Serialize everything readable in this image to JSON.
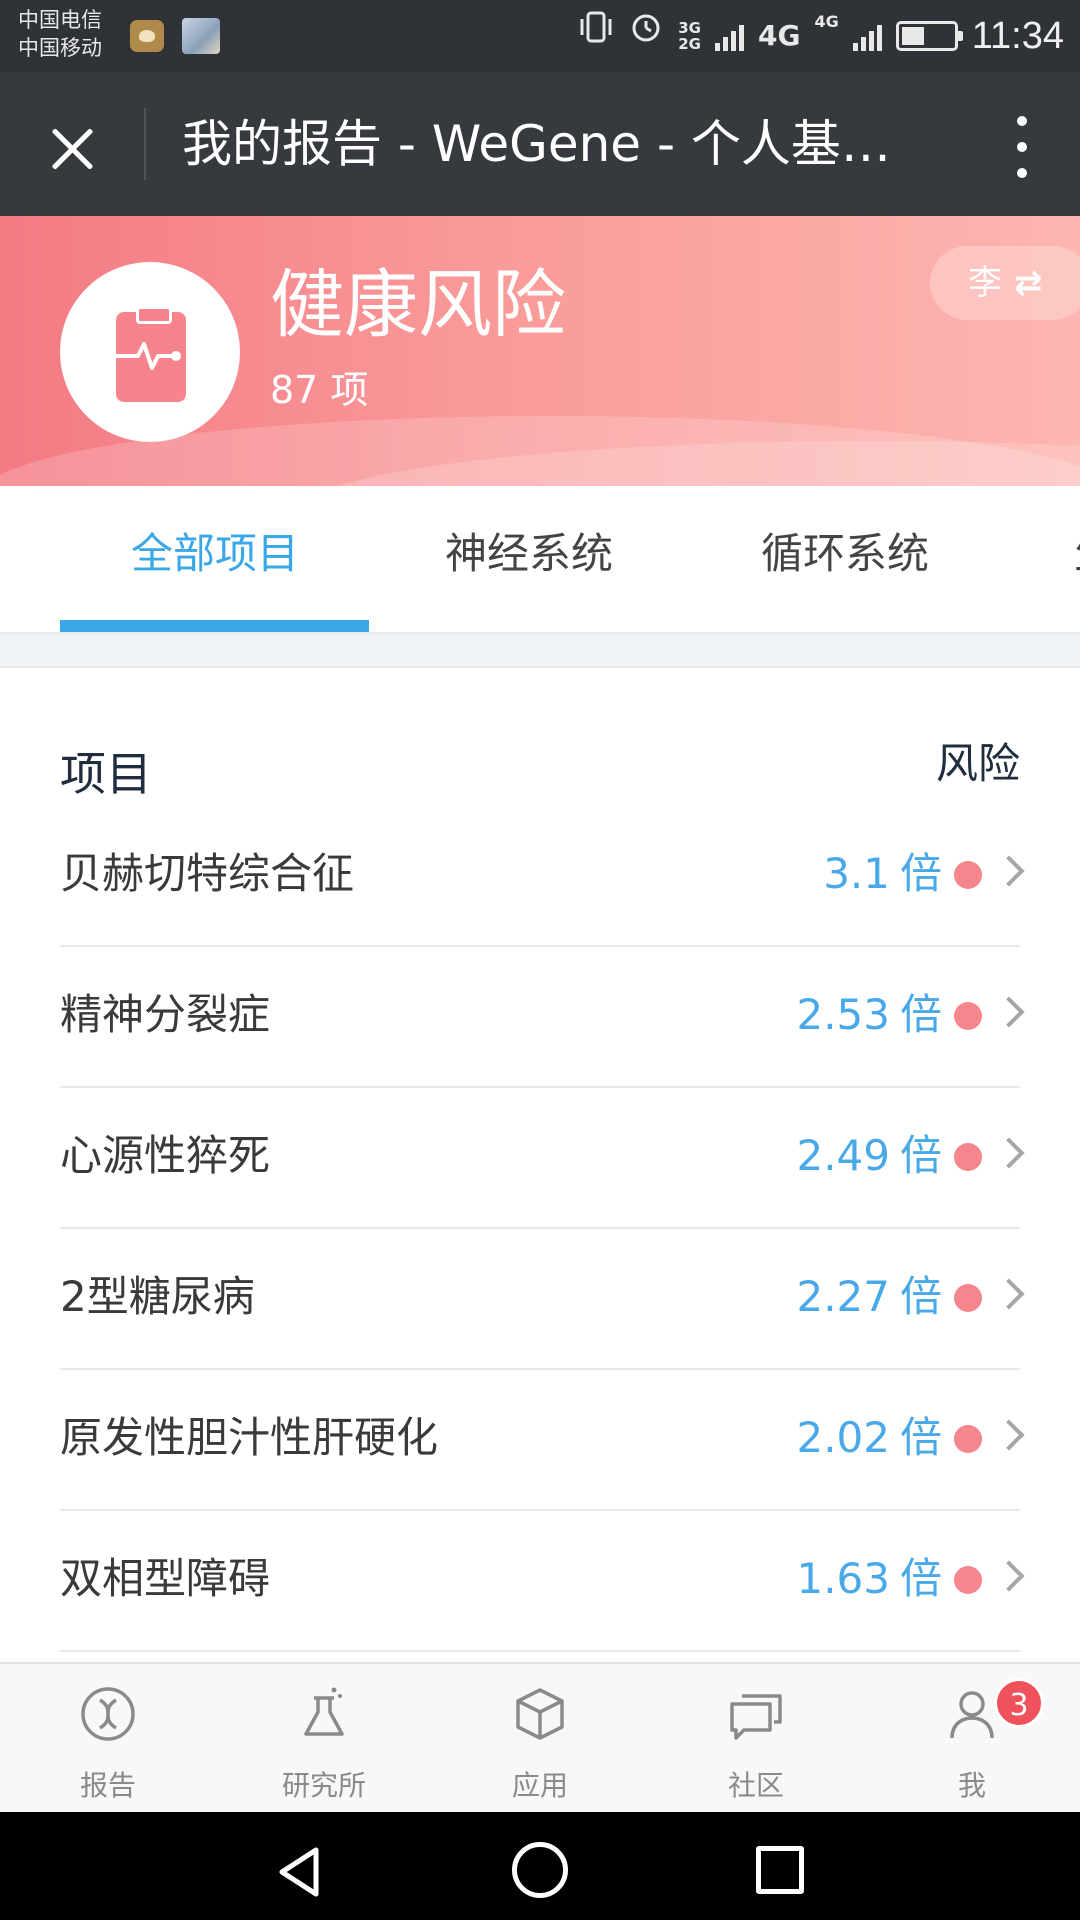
{
  "status_bar": {
    "carrier_1": "中国电信",
    "carrier_2": "中国移动",
    "net_3g": "3G",
    "net_2g": "2G",
    "net_4g_a": "4G",
    "net_4g_b": "4G",
    "time": "11:34",
    "icons": [
      "vibrate-icon",
      "alarm-icon",
      "signal-icon",
      "battery-icon"
    ]
  },
  "title_bar": {
    "title": "我的报告 - WeGene - 个人基…"
  },
  "category": {
    "title": "健康风险",
    "count": "87 项",
    "user_switch_label": "李",
    "swap_glyph": "⇄",
    "icon": "clipboard-pulse-icon"
  },
  "tabs": [
    {
      "label": "全部项目",
      "active": true
    },
    {
      "label": "神经系统",
      "active": false
    },
    {
      "label": "循环系统",
      "active": false
    },
    {
      "label": "生",
      "active": false
    }
  ],
  "list": {
    "header_left": "项目",
    "header_right": "风险",
    "rows": [
      {
        "name": "贝赫切特综合征",
        "value": "3.1",
        "unit": "倍"
      },
      {
        "name": "精神分裂症",
        "value": "2.53",
        "unit": "倍"
      },
      {
        "name": "心源性猝死",
        "value": "2.49",
        "unit": "倍"
      },
      {
        "name": "2型糖尿病",
        "value": "2.27",
        "unit": "倍"
      },
      {
        "name": "原发性胆汁性肝硬化",
        "value": "2.02",
        "unit": "倍"
      },
      {
        "name": "双相型障碍",
        "value": "1.63",
        "unit": "倍"
      }
    ]
  },
  "bottom_nav": [
    {
      "label": "报告",
      "icon": "dna-icon"
    },
    {
      "label": "研究所",
      "icon": "flask-icon"
    },
    {
      "label": "应用",
      "icon": "cube-icon"
    },
    {
      "label": "社区",
      "icon": "chat-icon"
    },
    {
      "label": "我",
      "icon": "person-icon",
      "badge": "3"
    }
  ],
  "colors": {
    "accent": "#3aa7e6",
    "banner_start": "#f47a84",
    "banner_end": "#fdb6b0",
    "risk_dot": "#f6868d",
    "badge": "#f0525b"
  }
}
